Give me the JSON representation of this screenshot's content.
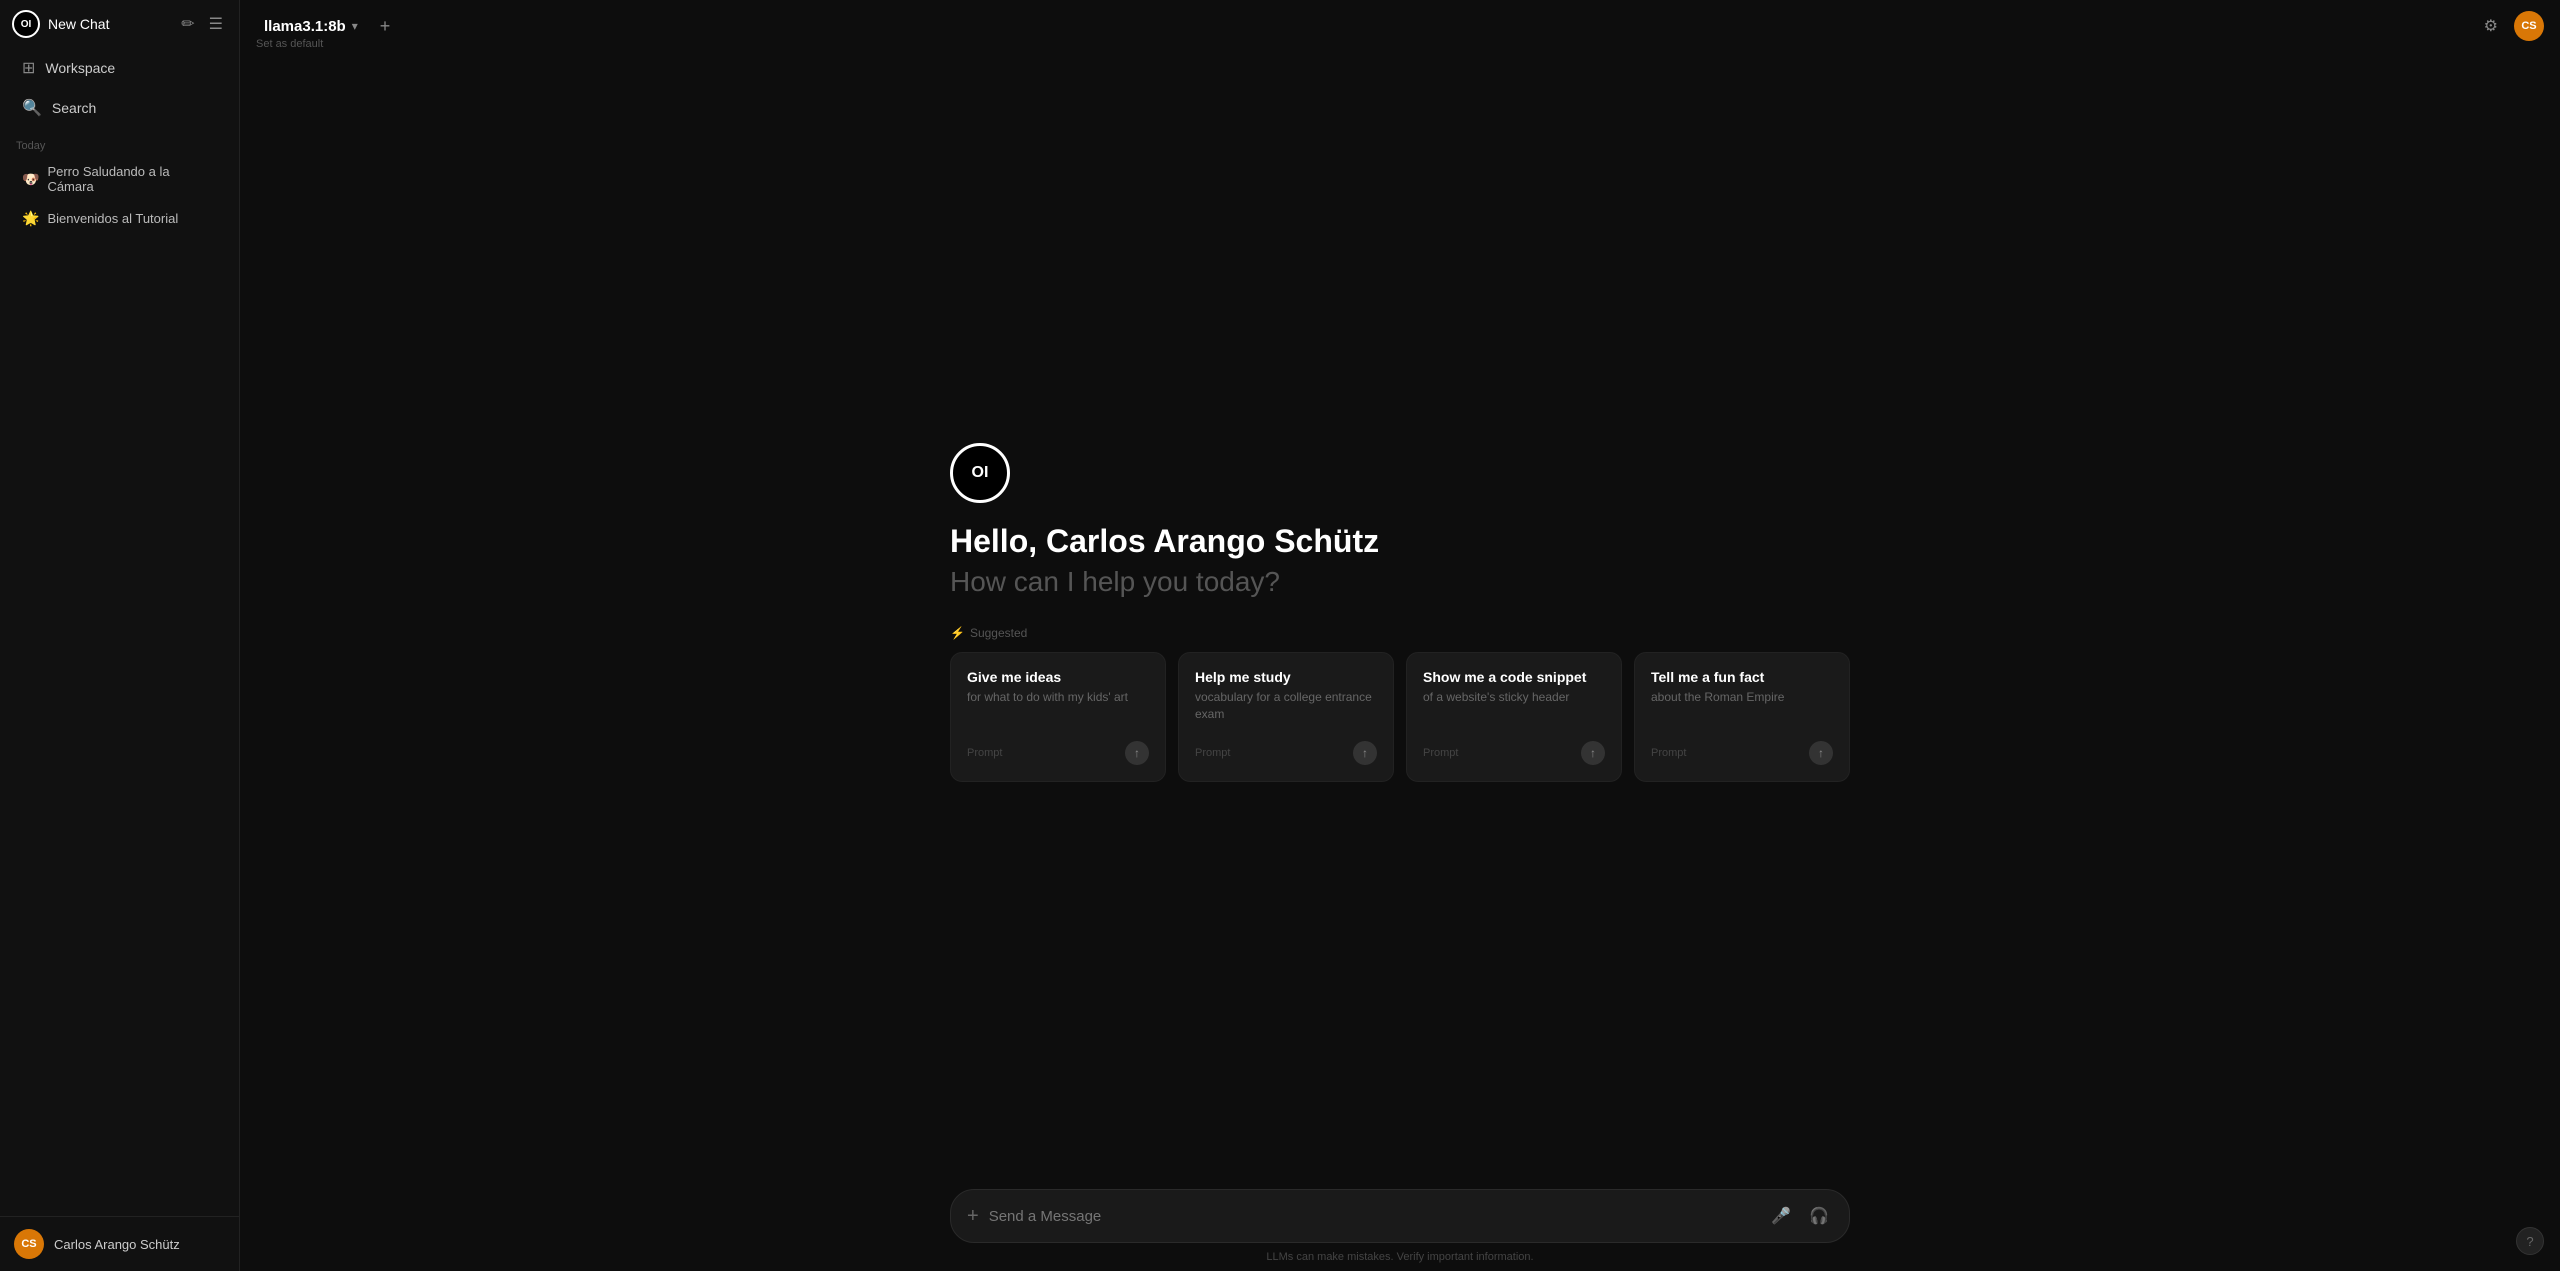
{
  "sidebar": {
    "logo": "OI",
    "new_chat": "New Chat",
    "nav_items": [
      {
        "icon": "⊞",
        "label": "Workspace"
      },
      {
        "icon": "🔍",
        "label": "Search"
      }
    ],
    "section_today": "Today",
    "chat_history": [
      {
        "emoji": "🐶",
        "label": "Perro Saludando a la Cámara"
      },
      {
        "emoji": "🌟",
        "label": "Bienvenidos al Tutorial"
      }
    ],
    "user": {
      "initials": "CS",
      "name": "Carlos Arango Schütz"
    }
  },
  "topbar": {
    "model_name": "llama3.1:8b",
    "add_label": "+",
    "set_default": "Set as default",
    "user_initials": "CS"
  },
  "welcome": {
    "logo": "OI",
    "title": "Hello, Carlos Arango Schütz",
    "subtitle": "How can I help you today?",
    "suggested_label": "Suggested",
    "cards": [
      {
        "title": "Give me ideas",
        "subtitle": "for what to do with my kids' art",
        "prompt_label": "Prompt"
      },
      {
        "title": "Help me study",
        "subtitle": "vocabulary for a college entrance exam",
        "prompt_label": "Prompt"
      },
      {
        "title": "Show me a code snippet",
        "subtitle": "of a website's sticky header",
        "prompt_label": "Prompt"
      },
      {
        "title": "Tell me a fun fact",
        "subtitle": "about the Roman Empire",
        "prompt_label": "Prompt"
      }
    ]
  },
  "input": {
    "placeholder": "Send a Message",
    "add_icon": "+",
    "mic_icon": "🎤",
    "headphone_icon": "🎧"
  },
  "disclaimer": "LLMs can make mistakes. Verify important information.",
  "help_label": "?"
}
